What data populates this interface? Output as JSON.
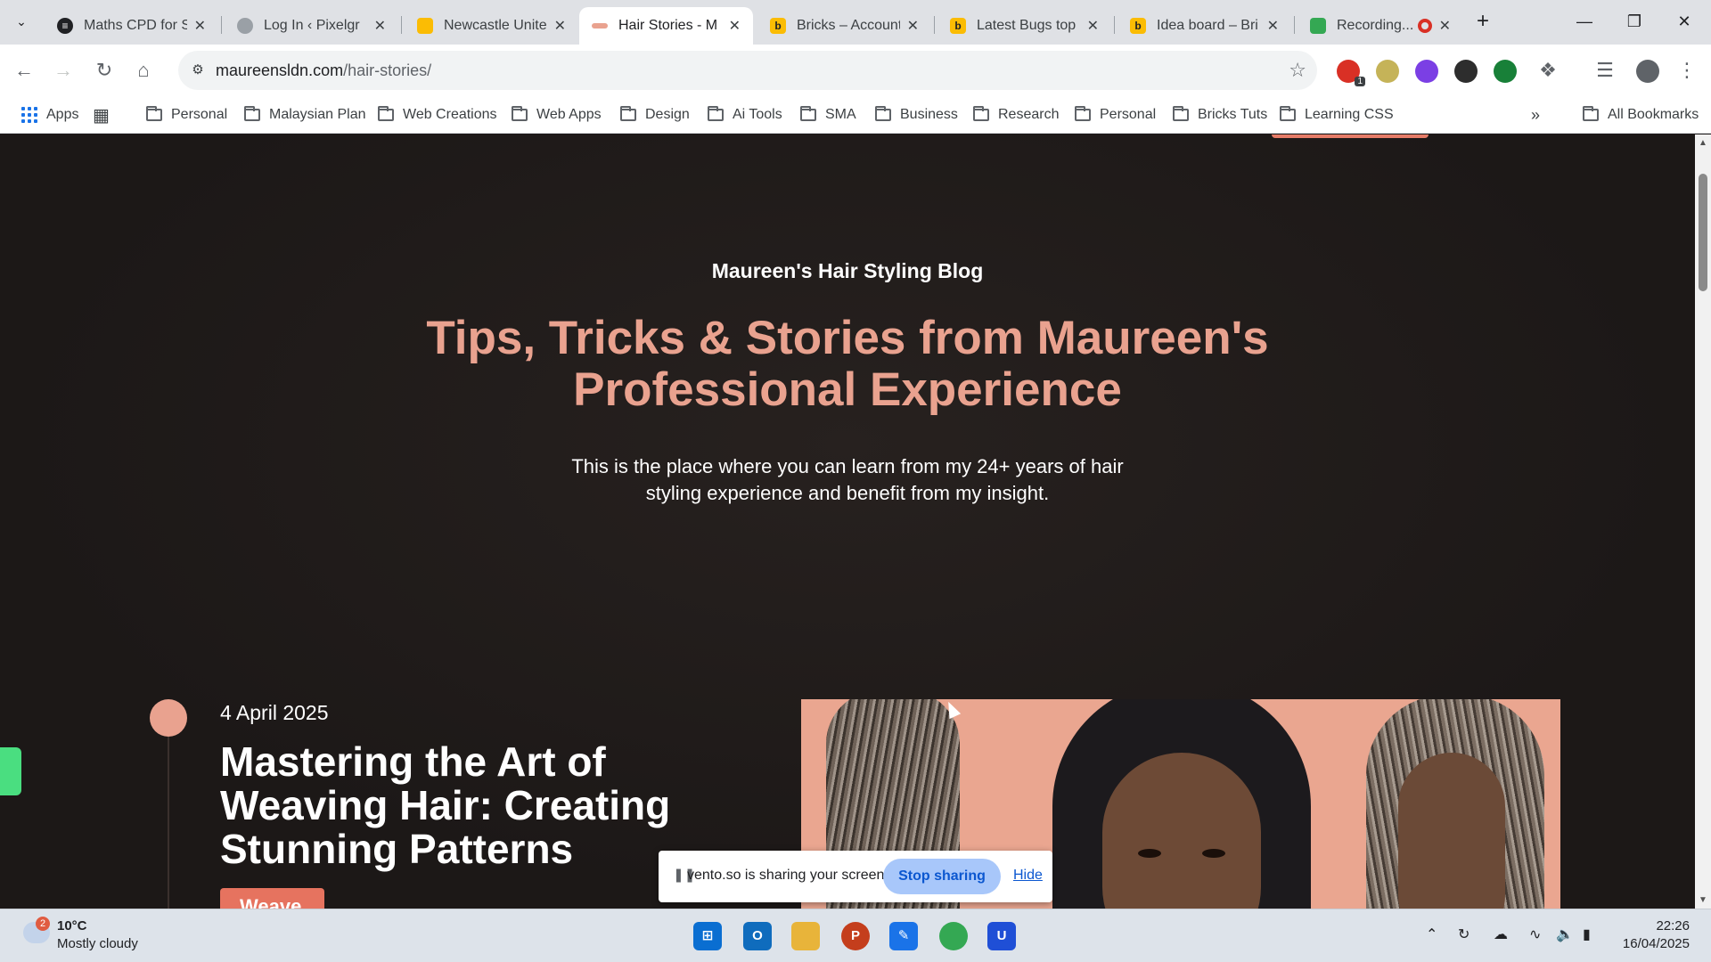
{
  "browser": {
    "tabs": [
      {
        "title": "Maths CPD for S",
        "color": "#202124",
        "active": false
      },
      {
        "title": "Log In ‹ Pixelgr",
        "color": "#9aa0a6",
        "active": false
      },
      {
        "title": "Newcastle Unite",
        "color": "#fbbc04",
        "active": false
      },
      {
        "title": "Hair Stories - M",
        "color": "#e9a28f",
        "active": true
      },
      {
        "title": "Bricks – Account",
        "color": "#fbbc04",
        "active": false
      },
      {
        "title": "Latest Bugs top",
        "color": "#fbbc04",
        "active": false
      },
      {
        "title": "Idea board – Bri",
        "color": "#fbbc04",
        "active": false
      },
      {
        "title": "Recording...",
        "color": "#34a853",
        "active": false
      }
    ],
    "url_domain": "maureensldn.com",
    "url_path": "/hair-stories/",
    "bookmarks": [
      "Apps",
      "Personal",
      "Malaysian Plan",
      "Web Creations",
      "Web Apps",
      "Design",
      "Ai Tools",
      "SMA",
      "Business",
      "Research",
      "Personal",
      "Bricks Tuts",
      "Learning CSS"
    ],
    "all_bookmarks": "All Bookmarks",
    "extension_badge": "1"
  },
  "page": {
    "blog_label": "Maureen's Hair Styling Blog",
    "hero_title": "Tips, Tricks & Stories from Maureen's Professional Experience",
    "hero_subtitle": "This is the place where you can learn from my 24+ years of hair styling experience and benefit from my insight.",
    "post": {
      "date": "4 April 2025",
      "title": "Mastering the Art of Weaving Hair: Creating Stunning Patterns",
      "tag": "Weave"
    },
    "accent_color": "#e9a28f"
  },
  "share_bar": {
    "text": "vento.so is sharing your screen.",
    "stop_label": "Stop sharing",
    "hide_label": "Hide"
  },
  "taskbar": {
    "weather_badge": "2",
    "temperature": "10°C",
    "weather": "Mostly cloudy",
    "time": "22:26",
    "date": "16/04/2025"
  }
}
